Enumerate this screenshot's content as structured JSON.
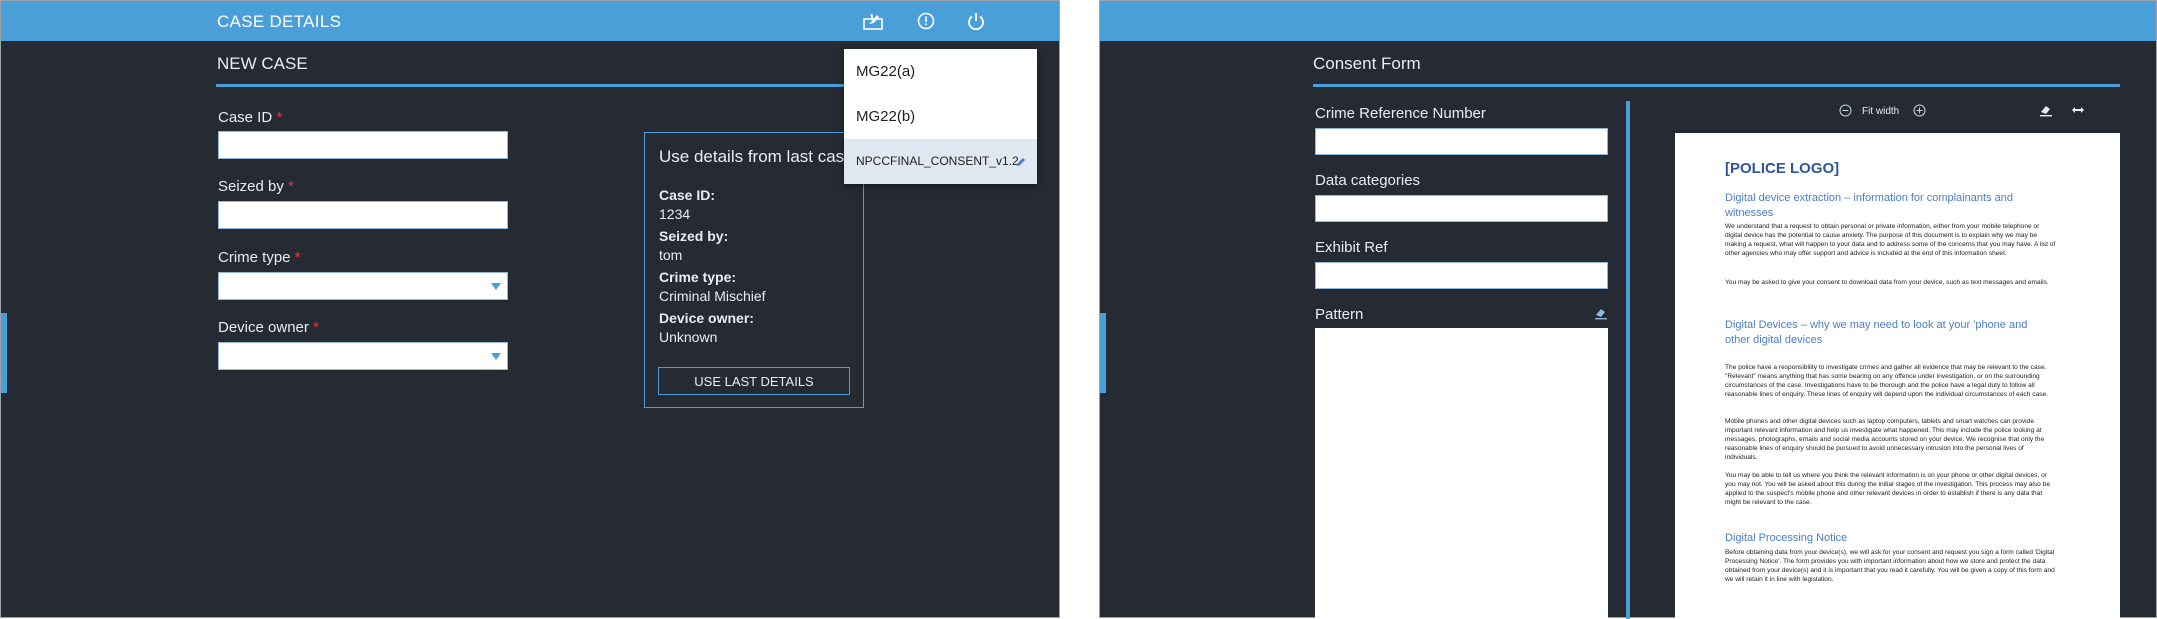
{
  "left": {
    "title": "CASE DETAILS",
    "section_title": "NEW CASE",
    "fields": {
      "case_id_label": "Case ID",
      "seized_by_label": "Seized by",
      "crime_type_label": "Crime type",
      "device_owner_label": "Device owner",
      "required_marker": "*",
      "case_id_value": "",
      "seized_by_value": "",
      "crime_type_value": "",
      "device_owner_value": ""
    },
    "last_case": {
      "heading": "Use details from last case:",
      "case_id_key": "Case ID:",
      "case_id": "1234",
      "seized_by_key": "Seized by:",
      "seized_by": "tom",
      "crime_type_key": "Crime type:",
      "crime_type": "Criminal Mischief",
      "device_owner_key": "Device owner:",
      "device_owner": "Unknown",
      "button": "USE LAST DETAILS"
    },
    "dropdown": {
      "items": [
        "MG22(a)",
        "MG22(b)",
        "NPCCFINAL_CONSENT_v1.2"
      ]
    },
    "icons": [
      "form-fill-icon",
      "info-icon",
      "power-icon",
      "pencil-icon",
      "chevron-down-icon"
    ]
  },
  "right": {
    "section_title": "Consent Form",
    "fields": {
      "crime_ref_label": "Crime Reference Number",
      "data_categories_label": "Data categories",
      "exhibit_ref_label": "Exhibit Ref",
      "pattern_label": "Pattern",
      "crime_ref_value": "",
      "data_categories_value": "",
      "exhibit_ref_value": ""
    },
    "doc_toolbar": {
      "fit_width": "Fit width"
    },
    "document": {
      "logo": "[POLICE LOGO]",
      "h1": "Digital device extraction – information for complainants and witnesses",
      "p1": "We understand that a request to obtain personal or private information, either from your mobile telephone or digital device has the potential to cause anxiety. The purpose of this document is to explain why we may be making a request, what will happen to your data and to address some of the concerns that you may have. A list of other agencies who may offer support and advice is included at the end of this information sheet.",
      "p2": "You may be asked to give your consent to download data from your device, such as text messages and emails.",
      "h2": "Digital Devices – why we may need to look at your 'phone and other digital devices",
      "p3": "The police have a responsibility to investigate crimes and gather all evidence that may be relevant to the case. \"Relevant\" means anything that has some bearing on any offence under investigation, or on the surrounding circumstances of the case. Investigations have to be thorough and the police have a legal duty to follow all reasonable lines of enquiry. These lines of enquiry will depend upon the individual circumstances of each case.",
      "p4": "Mobile phones and other digital devices such as laptop computers, tablets and smart watches can provide important relevant information and help us investigate what happened. This may include the police looking at messages, photographs, emails and social media accounts stored on your device. We recognise that only the reasonable lines of enquiry should be pursued to avoid unnecessary intrusion into the personal lives of individuals.",
      "p5": "You may be able to tell us where you think the relevant information is on your phone or other digital devices, or you may not. You will be asked about this during the initial stages of the investigation. This process may also be applied to the suspect's mobile phone and other relevant devices in order to establish if there is any data that might be relevant to the case.",
      "h3": "Digital Processing Notice",
      "p6": "Before obtaining data from your device(s), we will ask for your consent and request you sign a form called 'Digital Processing Notice'. The form provides you with important information about how we store and protect the data obtained from your device(s) and it is important that you read it carefully. You will be given a copy of this form and we will retain it in line with legislation."
    },
    "icons": [
      "zoom-out-icon",
      "zoom-in-icon",
      "eraser-icon",
      "resize-icon",
      "pattern-eraser-icon"
    ]
  },
  "colors": {
    "accent": "#4a9fd8",
    "panel_bg": "#252a33",
    "required": "#e23b3b"
  }
}
